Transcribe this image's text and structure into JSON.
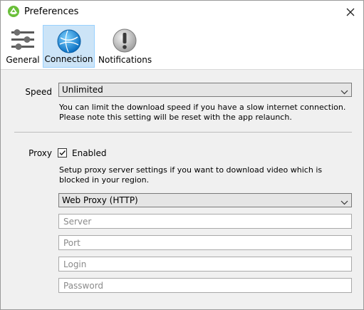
{
  "window": {
    "title": "Preferences"
  },
  "tabs": [
    {
      "label": "General"
    },
    {
      "label": "Connection"
    },
    {
      "label": "Notifications"
    }
  ],
  "speed": {
    "label": "Speed",
    "value": "Unlimited",
    "help": "You can limit the download speed if you have a slow internet connection. Please note this setting will be reset with the app relaunch."
  },
  "proxy": {
    "label": "Proxy",
    "enabled_label": "Enabled",
    "enabled": true,
    "help": "Setup proxy server settings if you want to download video which is blocked in your region.",
    "type_value": "Web Proxy (HTTP)",
    "server_placeholder": "Server",
    "port_placeholder": "Port",
    "login_placeholder": "Login",
    "password_placeholder": "Password"
  },
  "colors": {
    "accent": "#cce4f7",
    "app_icon": "#6abf3a"
  }
}
